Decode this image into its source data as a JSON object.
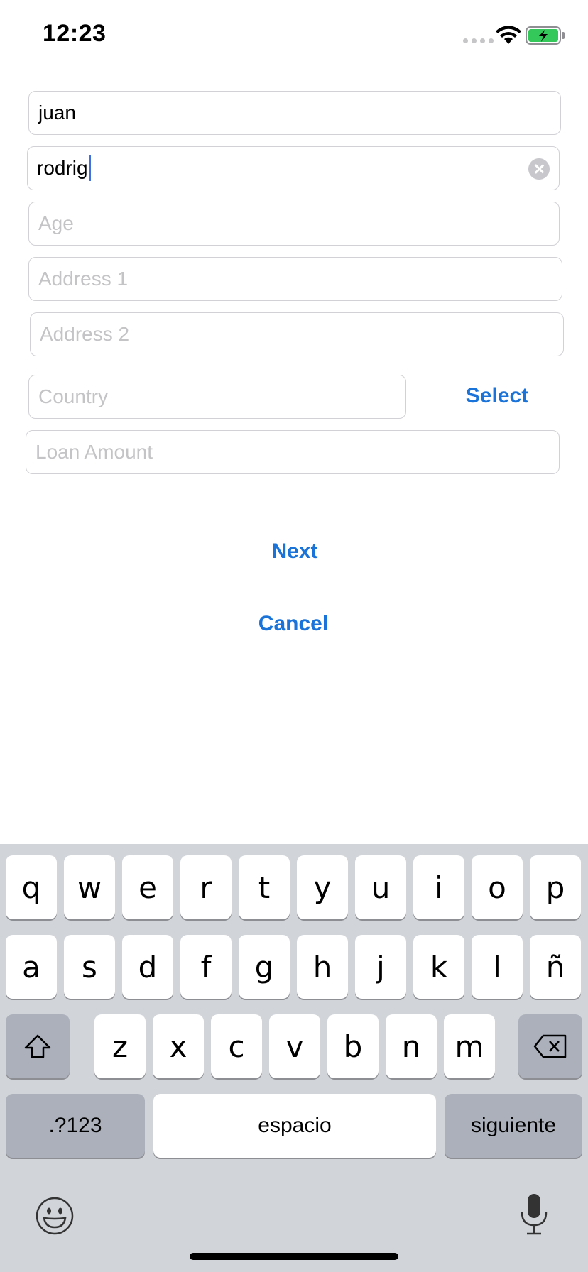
{
  "status_bar": {
    "time": "12:23"
  },
  "form": {
    "first_name": {
      "value": "juan",
      "placeholder": ""
    },
    "last_name": {
      "value": "rodrig",
      "placeholder": ""
    },
    "age": {
      "value": "",
      "placeholder": "Age"
    },
    "address1": {
      "value": "",
      "placeholder": "Address 1"
    },
    "address2": {
      "value": "",
      "placeholder": "Address 2"
    },
    "country": {
      "value": "",
      "placeholder": "Country"
    },
    "select_label": "Select",
    "loan_amount": {
      "value": "",
      "placeholder": "Loan Amount"
    },
    "next_label": "Next",
    "cancel_label": "Cancel"
  },
  "keyboard": {
    "row1": [
      "q",
      "w",
      "e",
      "r",
      "t",
      "y",
      "u",
      "i",
      "o",
      "p"
    ],
    "row2": [
      "a",
      "s",
      "d",
      "f",
      "g",
      "h",
      "j",
      "k",
      "l",
      "ñ"
    ],
    "row3": [
      "z",
      "x",
      "c",
      "v",
      "b",
      "n",
      "m"
    ],
    "numbers_label": ".?123",
    "space_label": "espacio",
    "return_label": "siguiente"
  },
  "colors": {
    "accent": "#1a73d9",
    "battery": "#34c759",
    "keyboard_bg": "#d1d4d9"
  }
}
